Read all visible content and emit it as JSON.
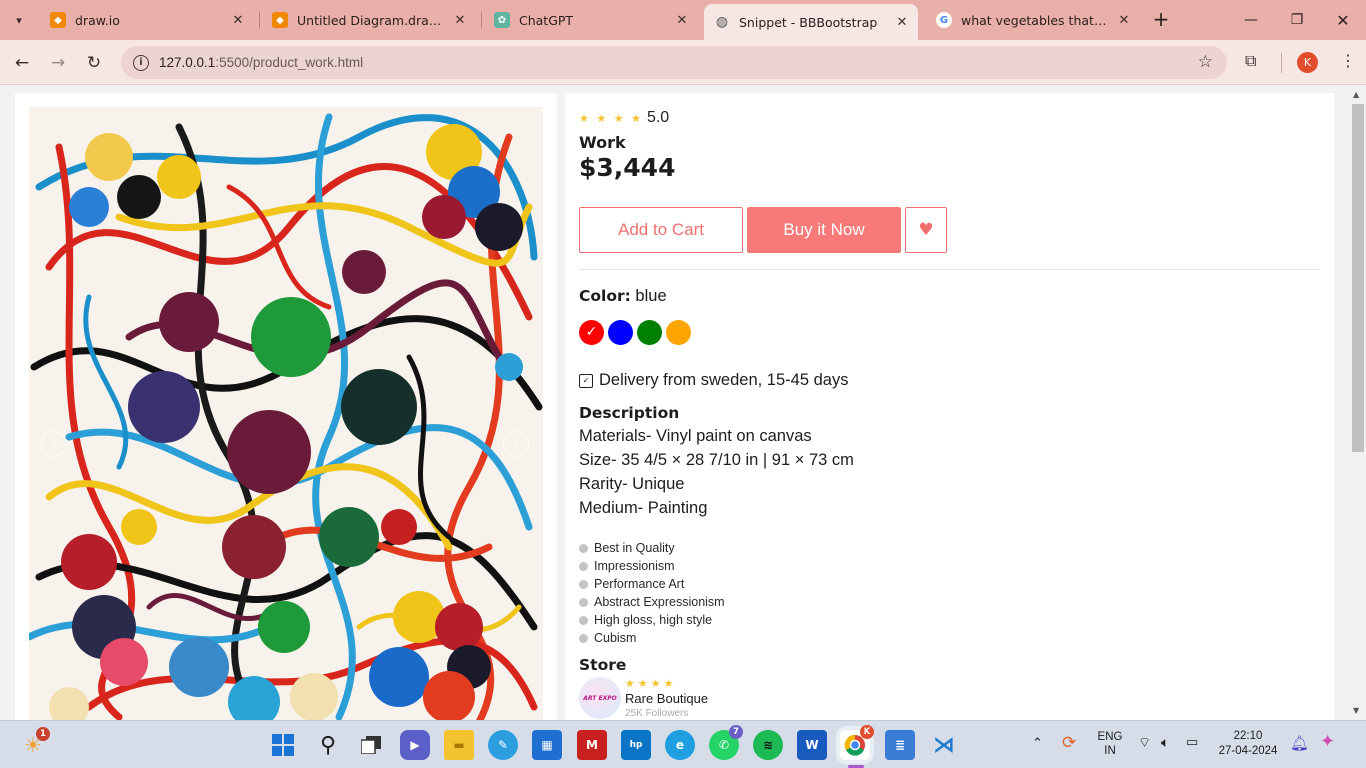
{
  "browser": {
    "tabs": [
      {
        "title": "draw.io",
        "icon": "drawio-icon",
        "active": false
      },
      {
        "title": "Untitled Diagram.drawio - d",
        "icon": "drawio-icon",
        "active": false
      },
      {
        "title": "ChatGPT",
        "icon": "chatgpt-icon",
        "active": false
      },
      {
        "title": "Snippet - BBBootstrap",
        "icon": "globe-icon",
        "active": true
      },
      {
        "title": "what vegetables that can gr",
        "icon": "google-icon",
        "active": false
      }
    ],
    "url_host": "127.0.0.1",
    "url_path": ":5500/product_work.html",
    "profile_initial": "K"
  },
  "product": {
    "stars": "★ ★ ★ ★",
    "rating": "5.0",
    "title": "Work",
    "price": "$3,444",
    "add_to_cart": "Add to Cart",
    "buy_now": "Buy it Now",
    "color_label": "Color:",
    "color_value": "blue",
    "swatches": [
      {
        "color": "#ff0000",
        "checked": true
      },
      {
        "color": "#0000ff",
        "checked": false
      },
      {
        "color": "#008000",
        "checked": false
      },
      {
        "color": "#ffa500",
        "checked": false
      }
    ],
    "check_mark": "✓",
    "delivery": "Delivery from sweden, 15-45 days",
    "description_heading": "Description",
    "description_lines": [
      "Materials- Vinyl paint on canvas",
      "Size- 35 4/5 × 28 7/10 in | 91 × 73 cm",
      "Rarity- Unique",
      "Medium- Painting"
    ],
    "tags": [
      "Best in Quality",
      "Impressionism",
      "Performance Art",
      "Abstract Expressionism",
      "High gloss, high style",
      "Cubism"
    ],
    "store_heading": "Store",
    "store": {
      "logo_text": "ART EXPO",
      "stars": "★★★★",
      "name": "Rare Boutique",
      "followers": "25K Followers"
    }
  },
  "taskbar": {
    "weather_badge": "1",
    "whatsapp_badge": "7",
    "chrome_badge": "K",
    "language": "ENG",
    "region": "IN",
    "time": "22:10",
    "date": "27-04-2024"
  }
}
